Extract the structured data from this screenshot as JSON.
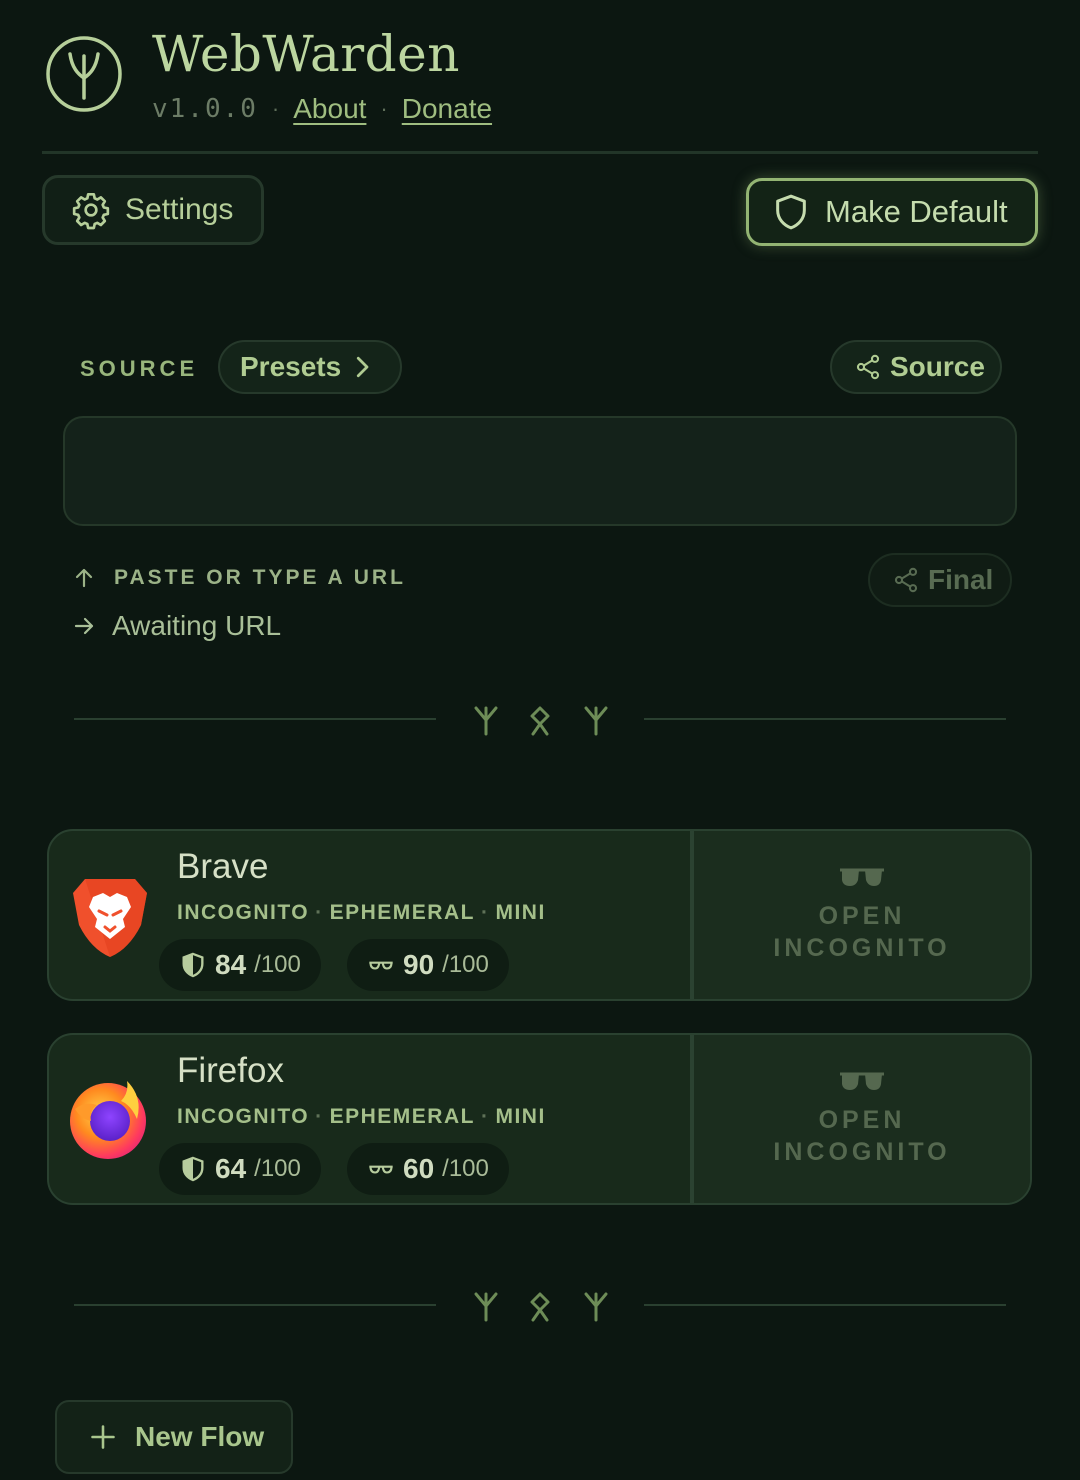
{
  "header": {
    "title": "WebWarden",
    "version": "v1.0.0",
    "about_link": "About",
    "donate_link": "Donate"
  },
  "toolbar": {
    "settings_label": "Settings",
    "make_default_label": "Make Default"
  },
  "source": {
    "section_label": "SOURCE",
    "presets_label": "Presets",
    "source_button_label": "Source",
    "url_value": "",
    "hint": "PASTE OR TYPE A URL",
    "status": "Awaiting URL",
    "final_button_label": "Final"
  },
  "browsers": [
    {
      "name": "Brave",
      "tags": [
        "INCOGNITO",
        "EPHEMERAL",
        "MINI"
      ],
      "privacy_score": "84",
      "privacy_max": "/100",
      "stealth_score": "90",
      "stealth_max": "/100",
      "action_line1": "OPEN",
      "action_line2": "INCOGNITO"
    },
    {
      "name": "Firefox",
      "tags": [
        "INCOGNITO",
        "EPHEMERAL",
        "MINI"
      ],
      "privacy_score": "64",
      "privacy_max": "/100",
      "stealth_score": "60",
      "stealth_max": "/100",
      "action_line1": "OPEN",
      "action_line2": "INCOGNITO"
    }
  ],
  "footer": {
    "new_flow_label": "New Flow"
  },
  "icons": {
    "logo": "algiz-rune-logo",
    "settings": "gear-icon",
    "make_default": "shield-icon",
    "presets": "chevron-right-icon",
    "source": "share-icon",
    "hint": "arrow-up-icon",
    "status": "arrow-right-icon",
    "privacy": "shield-half-icon",
    "stealth": "glasses-icon",
    "new_flow": "plus-icon"
  },
  "colors": {
    "background": "#0c1711",
    "accent": "#93b473",
    "text": "#b6cf9a",
    "card": "#182a1b"
  }
}
